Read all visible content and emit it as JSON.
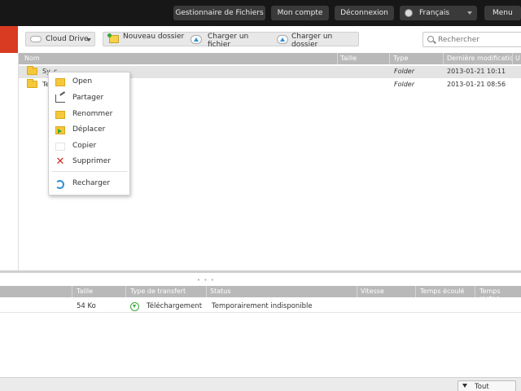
{
  "topbar": {
    "file_manager": "Gestionnaire de Fichiers",
    "account": "Mon compte",
    "logout": "Déconnexion",
    "language": "Français",
    "menu": "Menu"
  },
  "toolbar": {
    "drive_label": "Cloud Drive",
    "new_folder": "Nouveau dossier",
    "upload_file": "Charger un fichier",
    "upload_folder": "Charger un dossier",
    "search_placeholder": "Rechercher"
  },
  "file_table": {
    "columns": [
      "Nom",
      "Taille",
      "Type",
      "Dernière modificatio",
      "U"
    ],
    "rows": [
      {
        "name": "Sy",
        "name_suffix": "c",
        "size": "",
        "type": "Folder",
        "modified": "2013-01-21 10:11"
      },
      {
        "name": "Te",
        "size": "",
        "type": "Folder",
        "modified": "2013-01-21 08:56"
      }
    ]
  },
  "context_menu": {
    "items": [
      {
        "label": "Open",
        "icon": "folder-icon"
      },
      {
        "label": "Partager",
        "icon": "share-icon"
      },
      {
        "label": "Renommer",
        "icon": "rename-icon"
      },
      {
        "label": "Déplacer",
        "icon": "move-icon"
      },
      {
        "label": "Copier",
        "icon": "copy-icon"
      },
      {
        "label": "Supprimer",
        "icon": "delete-icon"
      },
      {
        "label": "Recharger",
        "icon": "reload-icon"
      }
    ]
  },
  "transfer_table": {
    "columns": [
      "Taille",
      "Type de transfert",
      "Status",
      "Vitesse",
      "Temps écoulé",
      "Temps restan"
    ],
    "rows": [
      {
        "size": "54 Ko",
        "transfer_type": "Téléchargement",
        "status": "Temporairement indisponible",
        "speed": "",
        "elapsed": "",
        "remaining": ""
      }
    ]
  },
  "bottombar": {
    "show_all": "Tout afficher"
  },
  "colors": {
    "topbar_bg": "#171717",
    "accent_red": "#d93a22",
    "header_gray": "#b9b9b9",
    "folder_yellow": "#f5c73a"
  }
}
